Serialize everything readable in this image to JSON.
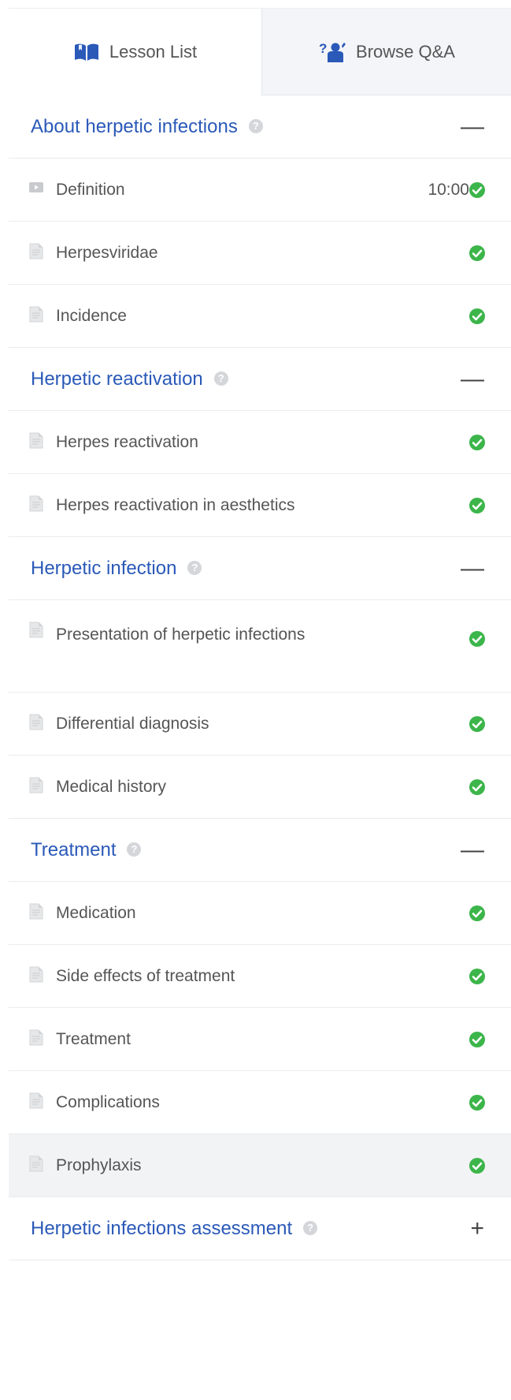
{
  "tabs": {
    "lessons_label": "Lesson List",
    "qa_label": "Browse Q&A"
  },
  "colors": {
    "accent_blue": "#2a59b8",
    "check_green": "#3cb54a",
    "tab_inactive_bg": "#f3f5f8"
  },
  "sections": [
    {
      "title": "About herpetic infections",
      "toggle": "—",
      "lessons": [
        {
          "title": "Definition",
          "type": "video",
          "duration": "10:00"
        },
        {
          "title": "Herpesviridae",
          "type": "document"
        },
        {
          "title": "Incidence",
          "type": "document"
        }
      ]
    },
    {
      "title": "Herpetic reactivation",
      "toggle": "—",
      "lessons": [
        {
          "title": "Herpes reactivation",
          "type": "document"
        },
        {
          "title": "Herpes reactivation in aesthetics",
          "type": "document"
        }
      ]
    },
    {
      "title": "Herpetic infection",
      "toggle": "—",
      "lessons": [
        {
          "title": "Presentation of herpetic infections",
          "type": "document"
        },
        {
          "title": "Differential diagnosis",
          "type": "document"
        },
        {
          "title": "Medical history",
          "type": "document"
        }
      ]
    },
    {
      "title": "Treatment",
      "toggle": "—",
      "lessons": [
        {
          "title": "Medication",
          "type": "document"
        },
        {
          "title": "Side effects of treatment",
          "type": "document"
        },
        {
          "title": "Treatment",
          "type": "document"
        },
        {
          "title": "Complications",
          "type": "document"
        },
        {
          "title": "Prophylaxis",
          "type": "document",
          "active": true
        }
      ]
    },
    {
      "title": "Herpetic infections assessment",
      "toggle": "+",
      "lessons": []
    }
  ]
}
